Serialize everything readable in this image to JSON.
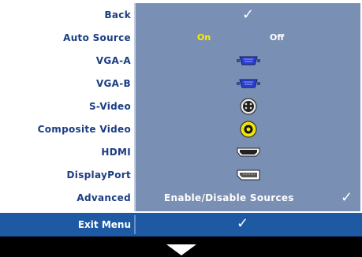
{
  "menu": {
    "items": [
      {
        "label": "Back"
      },
      {
        "label": "Auto Source"
      },
      {
        "label": "VGA-A"
      },
      {
        "label": "VGA-B"
      },
      {
        "label": "S-Video"
      },
      {
        "label": "Composite Video"
      },
      {
        "label": "HDMI"
      },
      {
        "label": "DisplayPort"
      },
      {
        "label": "Advanced"
      }
    ],
    "auto_source": {
      "on_label": "On",
      "off_label": "Off",
      "selected": "On"
    },
    "advanced_value": "Enable/Disable Sources",
    "check_glyph": "✓",
    "exit_label": "Exit Menu"
  },
  "icons": {
    "vga": "vga-connector-icon",
    "svideo": "s-video-connector-icon",
    "composite": "composite-rca-connector-icon",
    "hdmi": "hdmi-connector-icon",
    "displayport": "displayport-connector-icon",
    "more": "down-arrow-icon"
  },
  "colors": {
    "label_text": "#1a3d83",
    "panel_bg": "#7a8fb4",
    "exit_bar": "#1e5aa4",
    "on_highlight": "#ffee00"
  }
}
